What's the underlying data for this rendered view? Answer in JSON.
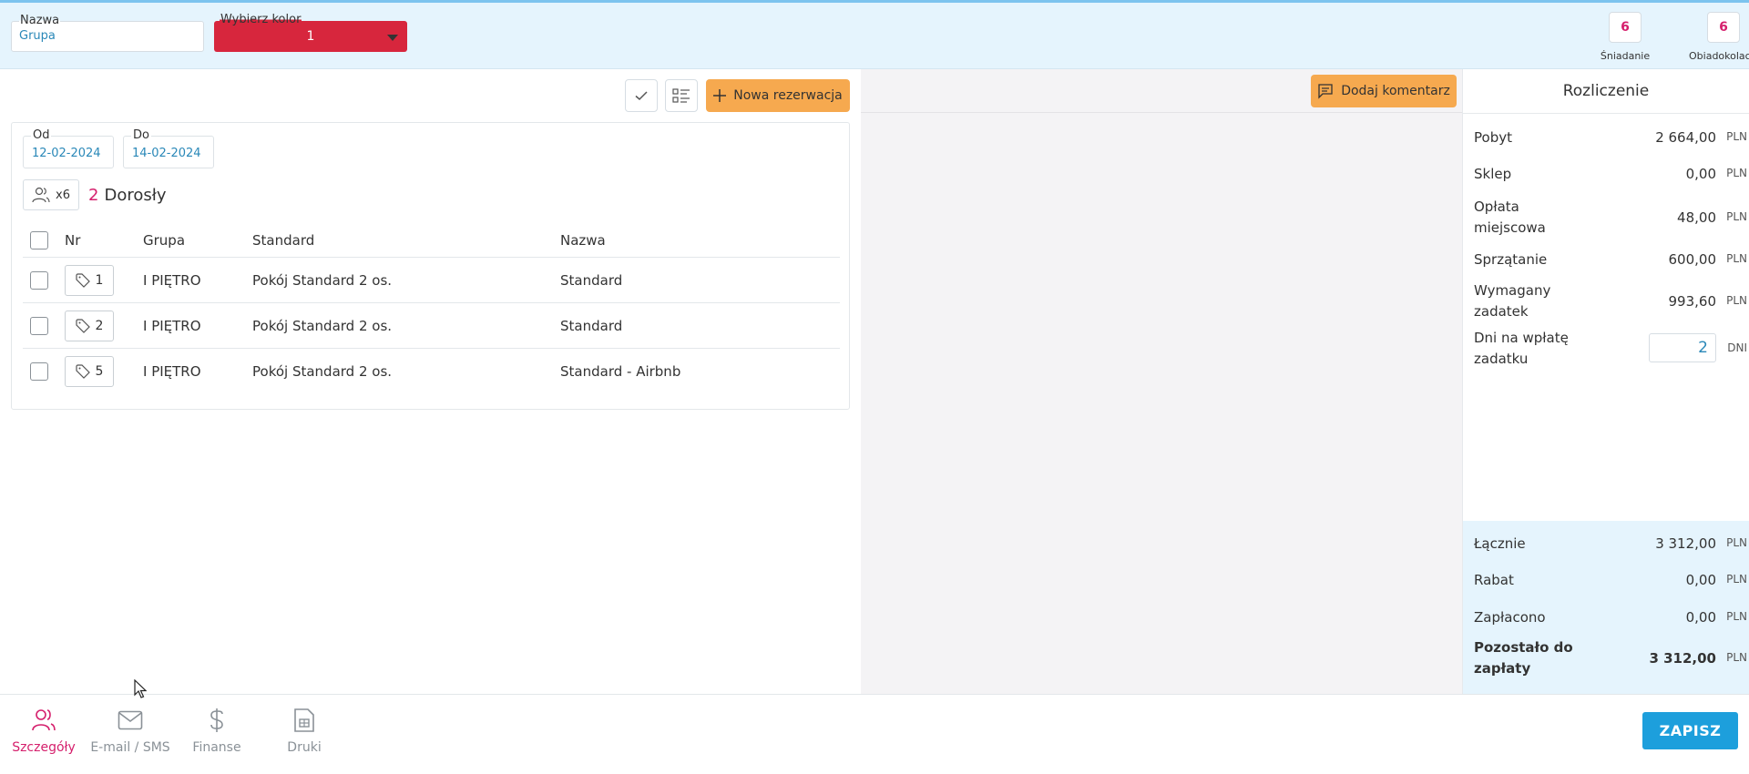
{
  "header": {
    "name_label": "Nazwa",
    "name_value": "Grupa",
    "color_label": "Wybierz kolor",
    "color_value": "1",
    "color_hex": "#d7263d",
    "meals": [
      {
        "count": "6",
        "label": "Śniadanie"
      },
      {
        "count": "6",
        "label": "Obiadokolacja"
      }
    ]
  },
  "toolbar": {
    "new_reservation_label": "Nowa rezerwacja"
  },
  "reservation": {
    "from_label": "Od",
    "from_value": "12-02-2024",
    "to_label": "Do",
    "to_value": "14-02-2024",
    "guests_multiplier": "x6",
    "guest_count": "2",
    "guest_type": "Dorosły",
    "columns": {
      "nr": "Nr",
      "grupa": "Grupa",
      "standard": "Standard",
      "nazwa": "Nazwa"
    },
    "rows": [
      {
        "nr": "1",
        "grupa": "I PIĘTRO",
        "standard": "Pokój Standard 2 os.",
        "nazwa": "Standard"
      },
      {
        "nr": "2",
        "grupa": "I PIĘTRO",
        "standard": "Pokój Standard 2 os.",
        "nazwa": "Standard"
      },
      {
        "nr": "5",
        "grupa": "I PIĘTRO",
        "standard": "Pokój Standard 2 os.",
        "nazwa": "Standard - Airbnb"
      }
    ]
  },
  "comments": {
    "add_comment_label": "Dodaj komentarz"
  },
  "summary": {
    "title": "Rozliczenie",
    "currency": "PLN",
    "pobyt_label": "Pobyt",
    "pobyt_value": "2 664,00",
    "sklep_label": "Sklep",
    "sklep_value": "0,00",
    "oplata_label_1": "Opłata",
    "oplata_label_2": "miejscowa",
    "oplata_value": "48,00",
    "sprzatanie_label": "Sprzątanie",
    "sprzatanie_value": "600,00",
    "zadatek_label_1": "Wymagany",
    "zadatek_label_2": "zadatek",
    "zadatek_value": "993,60",
    "dni_label_1": "Dni na wpłatę",
    "dni_label_2": "zadatku",
    "dni_value": "2",
    "dni_unit": "DNI",
    "lacznie_label": "Łącznie",
    "lacznie_value": "3 312,00",
    "rabat_label": "Rabat",
    "rabat_value": "0,00",
    "zaplacono_label": "Zapłacono",
    "zaplacono_value": "0,00",
    "pozostalo_label_1": "Pozostało do",
    "pozostalo_label_2": "zapłaty",
    "pozostalo_value": "3 312,00"
  },
  "bottom_nav": {
    "items": [
      {
        "label": "Szczegóły",
        "icon": "users-icon",
        "active": true
      },
      {
        "label": "E-mail / SMS",
        "icon": "mail-icon",
        "active": false
      },
      {
        "label": "Finanse",
        "icon": "dollar-icon",
        "active": false
      },
      {
        "label": "Druki",
        "icon": "document-icon",
        "active": false
      }
    ],
    "save_label": "ZAPISZ"
  },
  "colors": {
    "accent_orange": "#f6a94f",
    "accent_pink": "#d51f6c",
    "primary_blue": "#1d9fdc",
    "header_bg": "#e5f4fd"
  }
}
